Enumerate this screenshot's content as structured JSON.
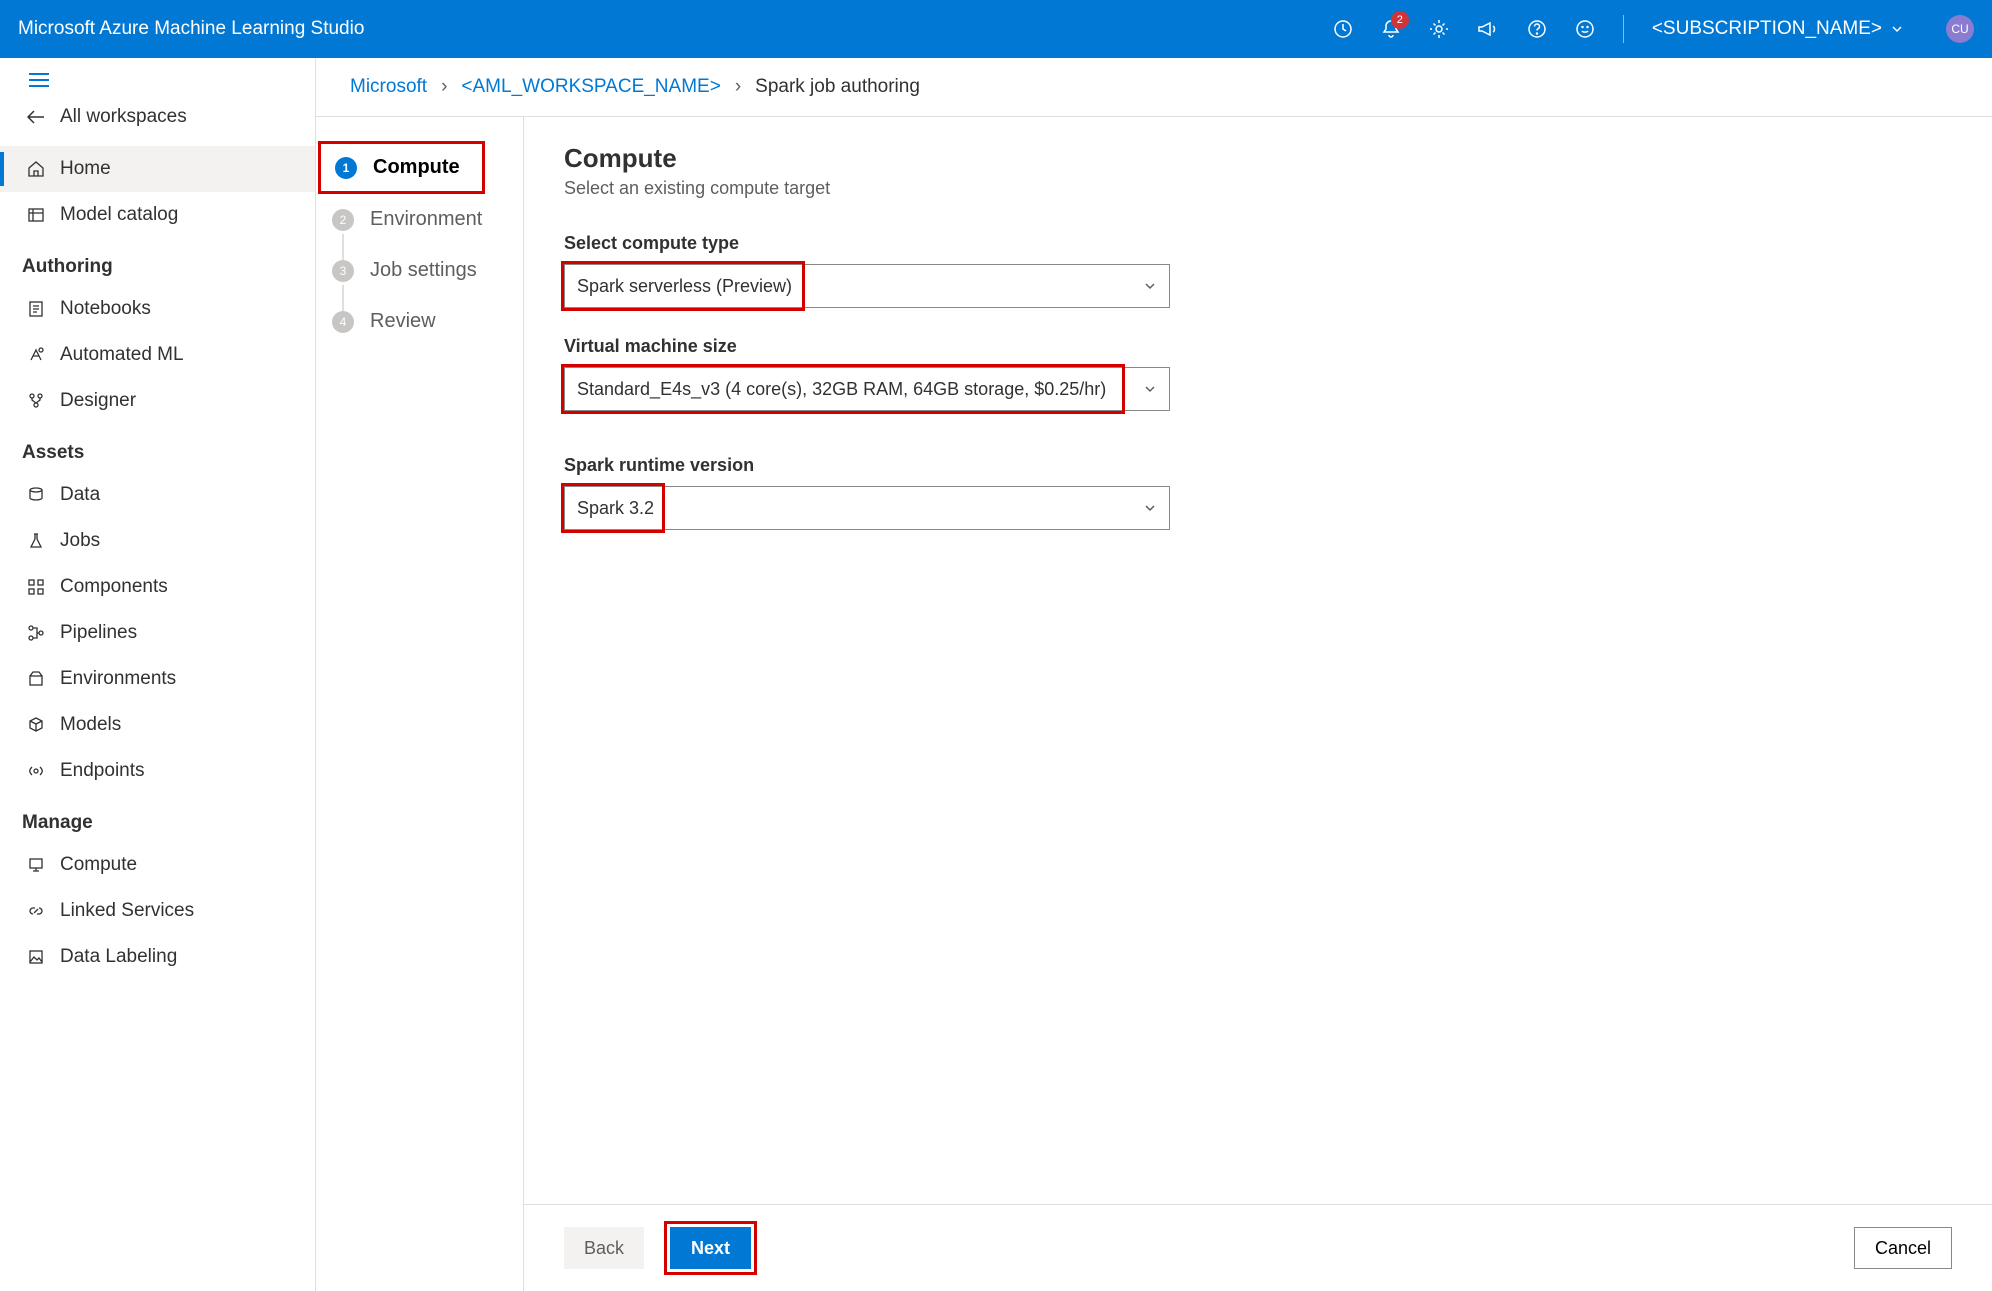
{
  "header": {
    "title": "Microsoft Azure Machine Learning Studio",
    "notification_count": "2",
    "subscription": "<SUBSCRIPTION_NAME>",
    "avatar": "CU"
  },
  "sidebar": {
    "back_label": "All workspaces",
    "home": "Home",
    "model_catalog": "Model catalog",
    "section_authoring": "Authoring",
    "notebooks": "Notebooks",
    "automl": "Automated ML",
    "designer": "Designer",
    "section_assets": "Assets",
    "data": "Data",
    "jobs": "Jobs",
    "components": "Components",
    "pipelines": "Pipelines",
    "environments": "Environments",
    "models": "Models",
    "endpoints": "Endpoints",
    "section_manage": "Manage",
    "compute": "Compute",
    "linked_services": "Linked Services",
    "data_labeling": "Data Labeling"
  },
  "breadcrumb": {
    "root": "Microsoft",
    "workspace": "<AML_WORKSPACE_NAME>",
    "current": "Spark job authoring"
  },
  "steps": {
    "s1": "Compute",
    "s2": "Environment",
    "s3": "Job settings",
    "s4": "Review"
  },
  "form": {
    "heading": "Compute",
    "subheading": "Select an existing compute target",
    "compute_type_label": "Select compute type",
    "compute_type_value": "Spark serverless (Preview)",
    "vm_size_label": "Virtual machine size",
    "vm_size_value": "Standard_E4s_v3 (4 core(s), 32GB RAM, 64GB storage, $0.25/hr)",
    "runtime_label": "Spark runtime version",
    "runtime_value": "Spark 3.2"
  },
  "footer": {
    "back": "Back",
    "next": "Next",
    "cancel": "Cancel"
  }
}
